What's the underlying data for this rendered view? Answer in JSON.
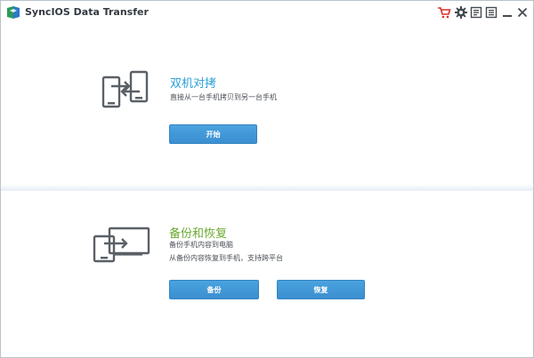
{
  "window": {
    "title": "SyncIOS Data Transfer"
  },
  "titlebar": {
    "buttons": [
      "cart-icon",
      "gear-icon",
      "feedback-icon",
      "menu-icon",
      "minimize-icon",
      "close-icon"
    ]
  },
  "phone_transfer": {
    "title": "双机对拷",
    "description": "直接从一台手机拷贝到另一台手机",
    "start_label": "开始"
  },
  "backup_restore": {
    "title": "备份和恢复",
    "description_line1": "备份手机内容到电脑",
    "description_line2": "从备份内容恢复到手机，支持跨平台",
    "backup_label": "备份",
    "restore_label": "恢复"
  },
  "colors": {
    "title_blue": "#2a9fd8",
    "title_green": "#6aa832",
    "button_blue": "#3b8fd0",
    "cart_red": "#d8302a",
    "icon_gray": "#5a6066"
  }
}
